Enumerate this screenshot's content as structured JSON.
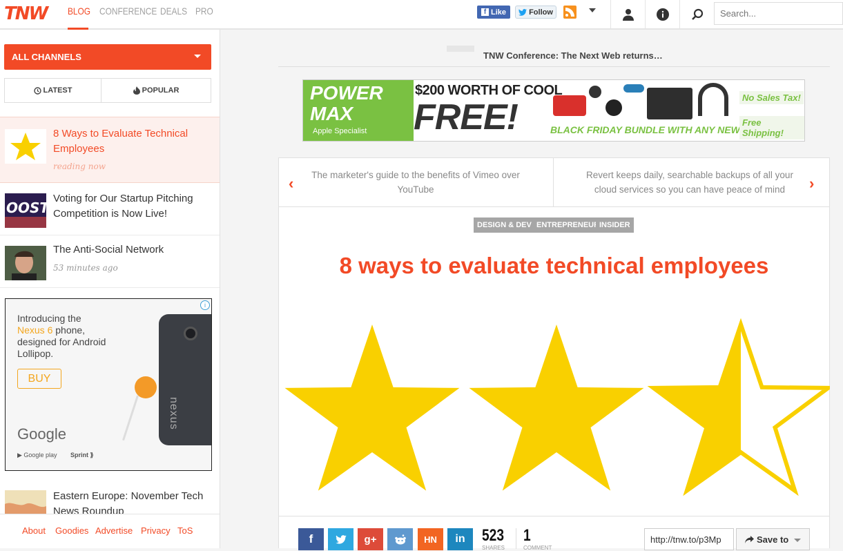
{
  "nav": {
    "logo": "TNW",
    "tabs": [
      "BLOG",
      "CONFERENCE",
      "DEALS",
      "PRO"
    ],
    "fb_like": "Like",
    "tw_follow": "Follow",
    "search_placeholder": "Search..."
  },
  "sidebar": {
    "channels": "ALL CHANNELS",
    "latest": "LATEST",
    "popular": "POPULAR",
    "articles": [
      {
        "title": "8 Ways to Evaluate Technical Employees",
        "time": "reading now"
      },
      {
        "title": "Voting for Our Startup Pitching Competition is Now Live!",
        "time": ""
      },
      {
        "title": "The Anti-Social Network",
        "time": "53 minutes ago"
      },
      {
        "title": "Eastern Europe: November Tech News Roundup",
        "time": ""
      }
    ],
    "ad": {
      "line1": "Introducing the",
      "highlight": "Nexus 6",
      "line2": " phone, designed for Android Lollipop.",
      "buy": "BUY",
      "google": "Google",
      "googleplay": "Google play",
      "sprint": "Sprint",
      "phone_brand": "nexus"
    },
    "footer": [
      "About",
      "Goodies",
      "Advertise",
      "Privacy",
      "ToS"
    ]
  },
  "main": {
    "promo": "TNW Conference: The Next Web returns…",
    "banner": {
      "logo1": "POWER",
      "logo2": "MAX",
      "apple": "Apple Specialist",
      "text1": "$200 WORTH OF COOL",
      "free": "FREE!",
      "bf": "BLACK FRIDAY BUNDLE WITH ANY NEW MAC",
      "badge1": "No Sales Tax!",
      "badge2": "Free Shipping!"
    },
    "prev": "The marketer's guide to the benefits of Vimeo over YouTube",
    "next": "Revert keeps daily, searchable backups of all your cloud services so you can have peace of mind",
    "tags": [
      "DESIGN & DEV",
      "ENTREPRENEUR",
      "INSIDER"
    ],
    "headline": "8 ways to evaluate technical employees",
    "rating": 2.5,
    "share": {
      "shares": "523",
      "shares_label": "SHARES",
      "comments": "1",
      "comments_label": "COMMENT",
      "short_url": "http://tnw.to/p3Mp",
      "save_to": "Save to"
    }
  },
  "colors": {
    "accent": "#f24a26",
    "star": "#f9d000"
  }
}
